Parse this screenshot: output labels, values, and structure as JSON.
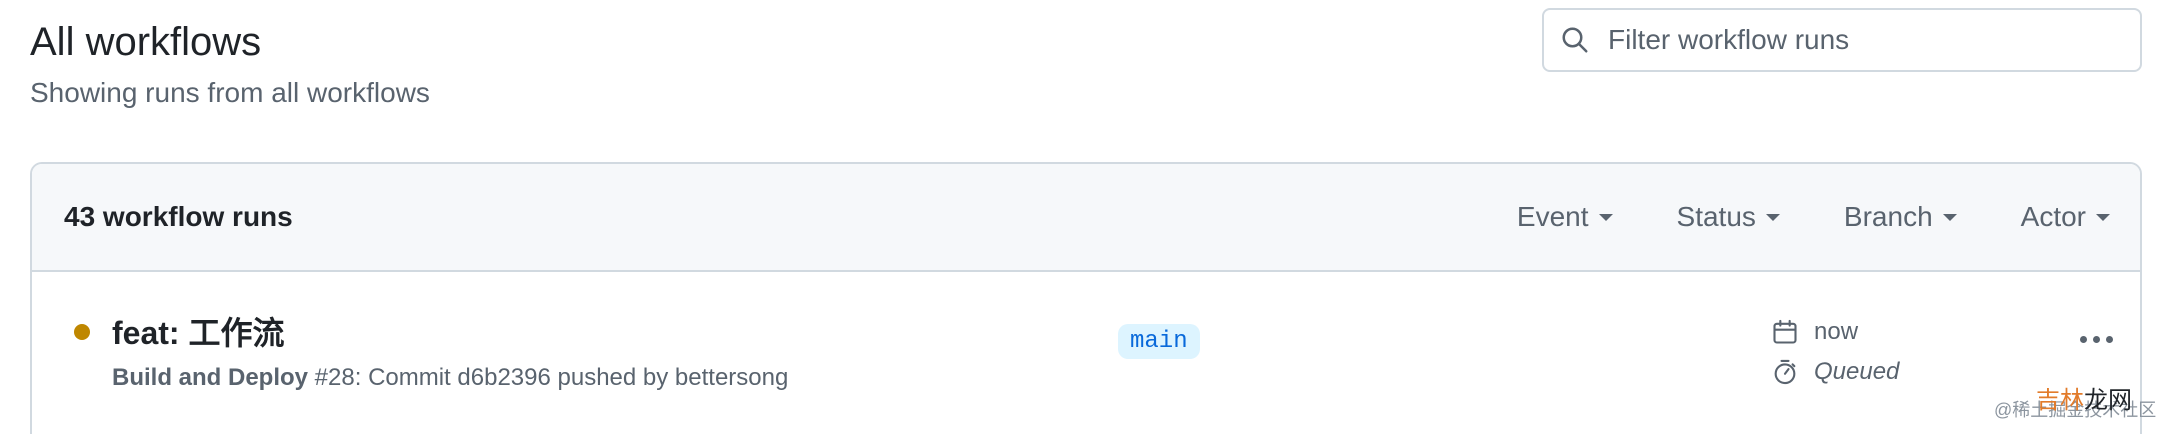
{
  "header": {
    "title": "All workflows",
    "subtitle": "Showing runs from all workflows"
  },
  "search": {
    "placeholder": "Filter workflow runs",
    "icon": "search-icon"
  },
  "runs_header": {
    "count_label": "43 workflow runs",
    "filters": [
      "Event",
      "Status",
      "Branch",
      "Actor"
    ]
  },
  "runs": [
    {
      "title": "feat: 工作流",
      "workflow_name": "Build and Deploy",
      "description": " #28: Commit d6b2396 pushed by bettersong",
      "branch": "main",
      "time": "now",
      "duration_status": "Queued",
      "status_color": "#bf8700"
    }
  ],
  "watermark": {
    "prefix": "@稀土掘金技术社区",
    "overlay_part1": "吉林",
    "overlay_part2": "龙网"
  },
  "colors": {
    "accent": "#0969da",
    "queued": "#bf8700",
    "muted": "#59636e",
    "border": "#d1d9e0"
  }
}
